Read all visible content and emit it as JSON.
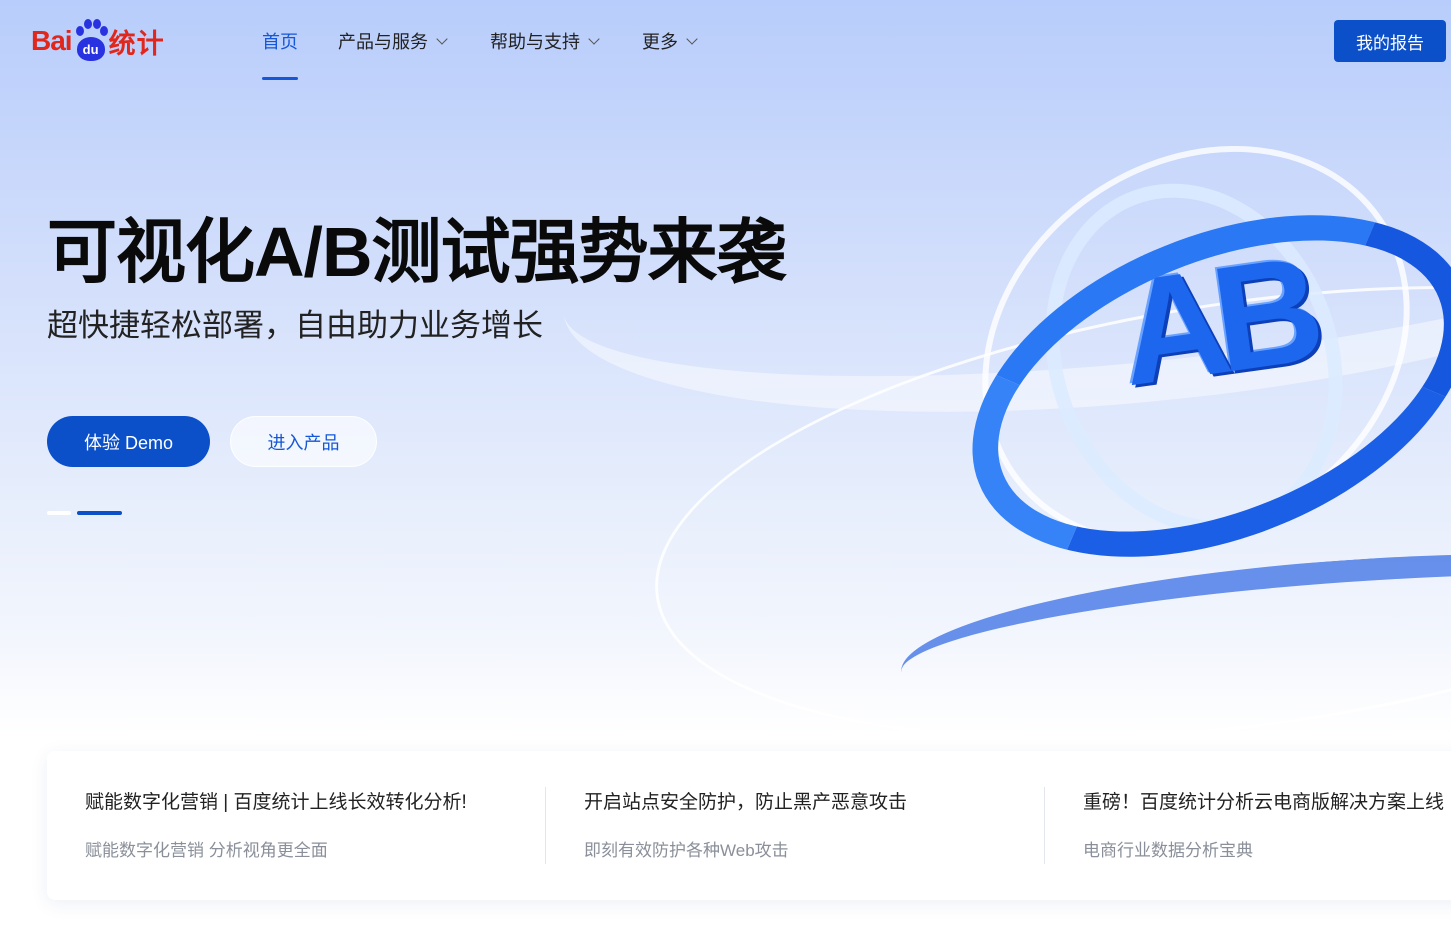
{
  "logo": {
    "bai": "Bai",
    "du": "du",
    "tongji": "统计"
  },
  "nav": {
    "items": [
      {
        "label": "首页",
        "active": true,
        "has_dropdown": false
      },
      {
        "label": "产品与服务",
        "active": false,
        "has_dropdown": true
      },
      {
        "label": "帮助与支持",
        "active": false,
        "has_dropdown": true
      },
      {
        "label": "更多",
        "active": false,
        "has_dropdown": true
      }
    ],
    "report_button": "我的报告"
  },
  "hero": {
    "headline": "可视化A/B测试强势来袭",
    "subline": "超快捷轻松部署，自由助力业务增长",
    "demo_button": "体验 Demo",
    "enter_button": "进入产品",
    "graphic_text": "AB",
    "carousel": {
      "slides": 2,
      "active_index": 1
    }
  },
  "news": [
    {
      "title": "赋能数字化营销 | 百度统计上线长效转化分析!",
      "sub": "赋能数字化营销 分析视角更全面"
    },
    {
      "title": "开启站点安全防护，防止黑产恶意攻击",
      "sub": "即刻有效防护各种Web攻击"
    },
    {
      "title": "重磅！百度统计分析云电商版解决方案上线",
      "sub": "电商行业数据分析宝典"
    }
  ],
  "colors": {
    "brand_blue": "#0b4fc9",
    "nav_active": "#1557d6",
    "logo_red": "#e1261c",
    "logo_blue": "#2932e1"
  }
}
